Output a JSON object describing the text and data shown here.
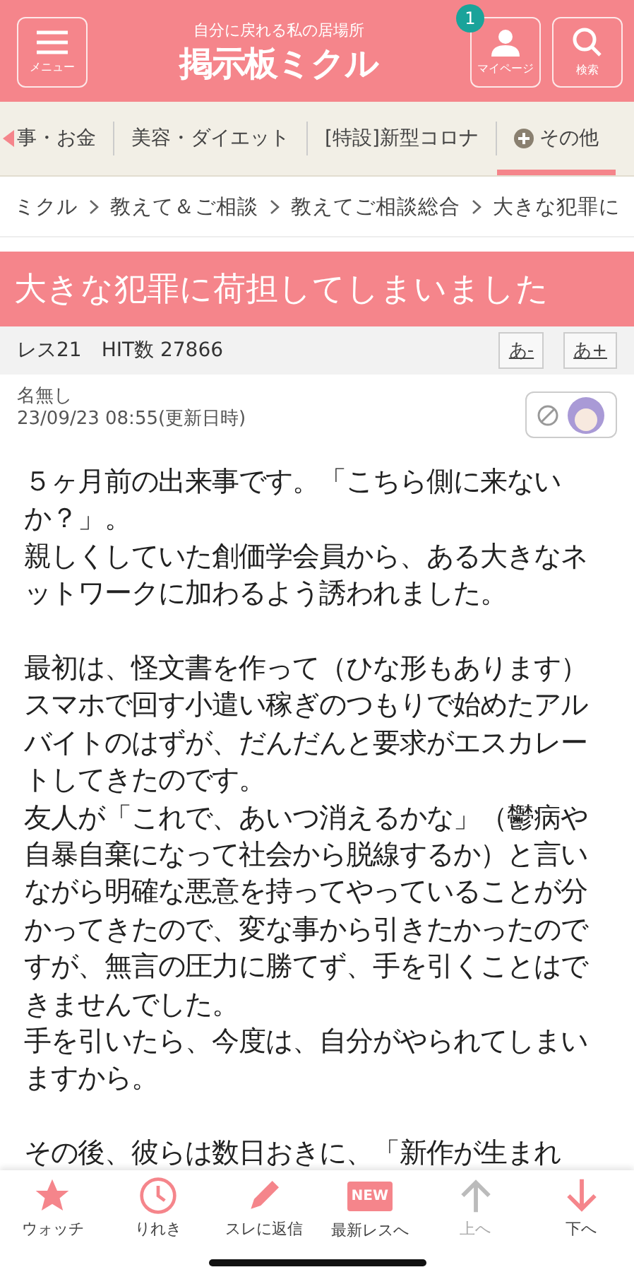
{
  "header": {
    "menu_label": "メニュー",
    "tagline": "自分に戻れる私の居場所",
    "logo": "掲示板ミクル",
    "mypage_label": "マイページ",
    "mypage_badge": "1",
    "search_label": "検索"
  },
  "categories": [
    {
      "label": "事・お金",
      "selected": false,
      "kind": "text"
    },
    {
      "label": "美容・ダイエット",
      "selected": false,
      "kind": "text"
    },
    {
      "label": "[特設]新型コロナ",
      "selected": false,
      "kind": "text"
    },
    {
      "label": "その他",
      "selected": true,
      "kind": "plus"
    }
  ],
  "breadcrumb": [
    "ミクル",
    "教えて＆ご相談",
    "教えてご相談総合",
    "大きな犯罪に"
  ],
  "thread": {
    "title": "大きな犯罪に荷担してしまいました",
    "res_count": "レス21",
    "hits": "HIT数 27866",
    "font_smaller": "あ-",
    "font_larger": "あ+"
  },
  "post": {
    "author": "名無し",
    "date": "23/09/23 08:55(更新日時)",
    "body": [
      [
        "５ヶ月前の出来事です。「こちら側に来ないか？」。",
        "親しくしていた創価学会員から、ある大きなネットワークに加わるよう誘われました。"
      ],
      [
        "最初は、怪文書を作って（ひな形もあります）スマホで回す小遣い稼ぎのつもりで始めたアルバイトのはずが、だんだんと要求がエスカレートしてきたのです。",
        "友人が「これで、あいつ消えるかな」（鬱病や自暴自棄になって社会から脱線するか）と言いながら明確な悪意を持ってやっていることが分かってきたので、変な事から引きたかったのですが、無言の圧力に勝てず、手を引くことはできませんでした。",
        "手を引いたら、今度は、自分がやられてしまいますから。"
      ],
      [
        "その後、彼らは数日おきに、「新作が生まれ"
      ]
    ]
  },
  "bottom_nav": [
    {
      "kind": "star",
      "label": "ウォッチ",
      "disabled": false
    },
    {
      "kind": "clock",
      "label": "りれき",
      "disabled": false
    },
    {
      "kind": "pencil",
      "label": "スレに返信",
      "disabled": false
    },
    {
      "kind": "new",
      "label": "最新レスへ",
      "badge": "NEW",
      "disabled": false
    },
    {
      "kind": "up",
      "label": "上へ",
      "disabled": true
    },
    {
      "kind": "down",
      "label": "下へ",
      "disabled": false
    }
  ]
}
